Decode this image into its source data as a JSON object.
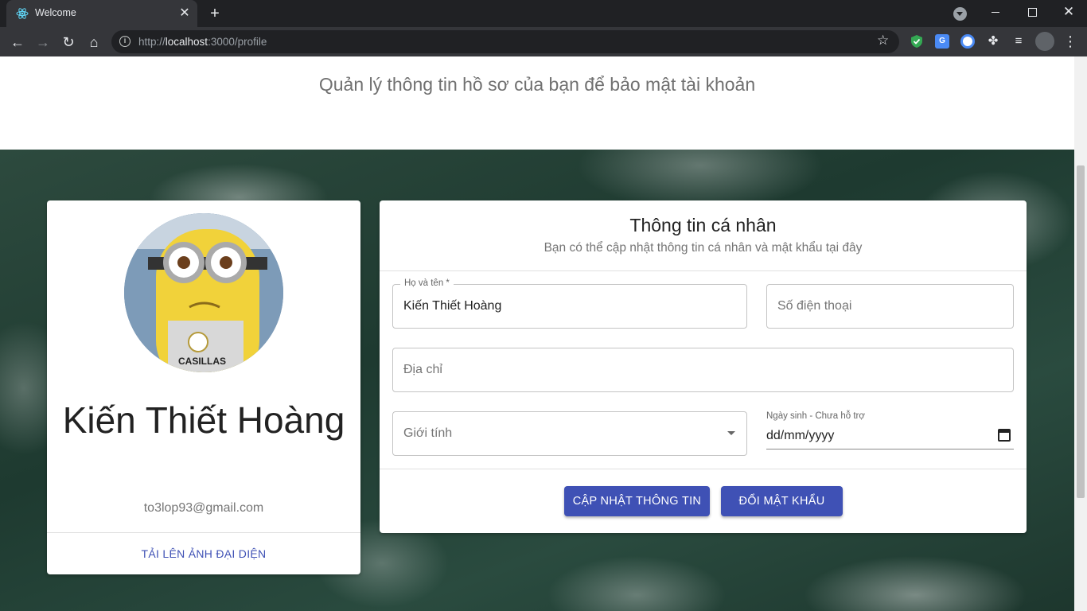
{
  "browser": {
    "tab_title": "Welcome",
    "new_tab": "+",
    "url_prefix": "http://",
    "url_host": "localhost",
    "url_path": ":3000/profile",
    "translate_ext": "G"
  },
  "page": {
    "subtitle": "Quản lý thông tin hồ sơ của bạn để bảo mật tài khoản"
  },
  "profile_card": {
    "name": "Kiến Thiết Hoàng",
    "email": "to3lop93@gmail.com",
    "upload_label": "TẢI LÊN ẢNH ĐẠI DIỆN",
    "avatar_text": "CASILLAS"
  },
  "info_card": {
    "title": "Thông tin cá nhân",
    "subtitle": "Bạn có thể cập nhật thông tin cá nhân và mật khẩu tại đây",
    "fields": {
      "fullname_label": "Họ và tên *",
      "fullname_value": "Kiến Thiết Hoàng",
      "phone_placeholder": "Số điện thoại",
      "address_placeholder": "Địa chỉ",
      "gender_placeholder": "Giới tính",
      "birthday_label": "Ngày sinh - Chưa hỗ trợ",
      "birthday_value": "dd/mm/yyyy"
    },
    "update_button": "CẬP NHẬT THÔNG TIN",
    "password_button": "ĐỔI MẬT KHẨU"
  },
  "colors": {
    "primary": "#3f51b5",
    "browser_dark": "#202124",
    "hero_green": "#2d4a3e"
  }
}
